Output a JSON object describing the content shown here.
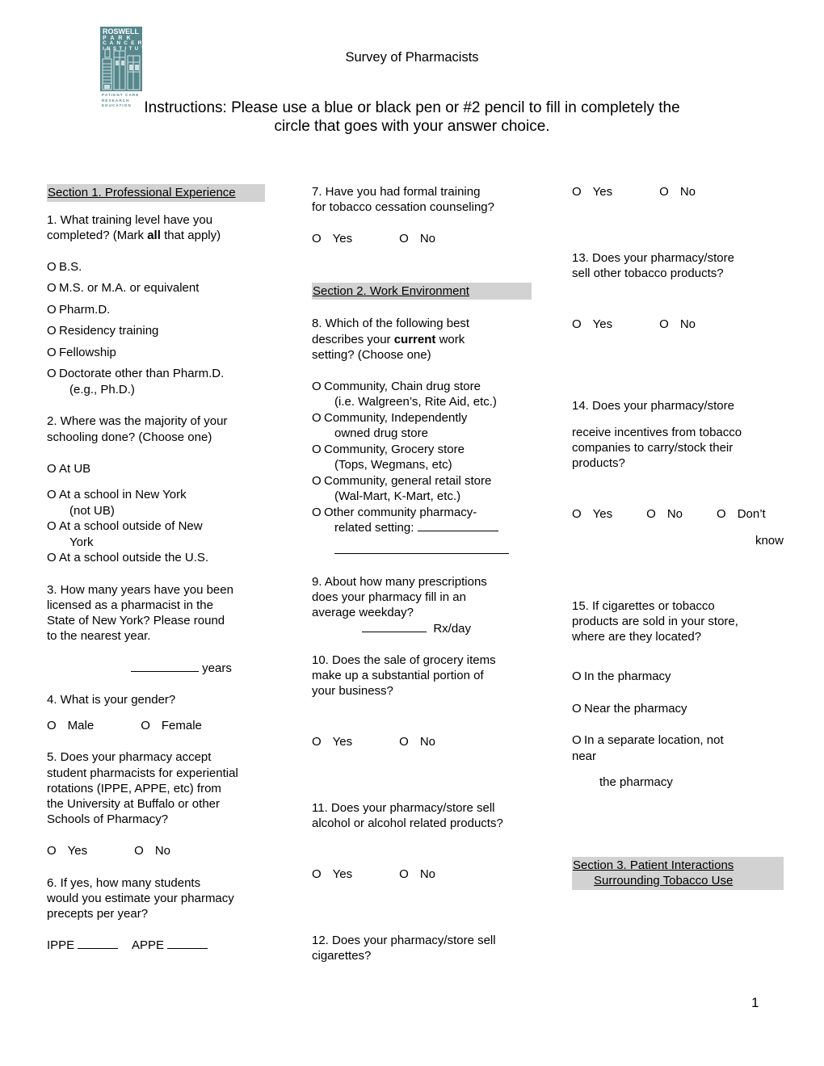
{
  "header": {
    "logo": {
      "name": "Roswell Park Cancer Institute",
      "line1": "ROSWELL",
      "line2": "P A R K",
      "line3": "C A N C E R",
      "line4": "I N S T I T U T E",
      "tag1": "PATIENT CARE",
      "tag2": "RESEARCH",
      "tag3": "EDUCATION",
      "color": "#55878c"
    },
    "title": "Survey of Pharmacists",
    "instructions_line1": "Instructions: Please use a blue or black pen or #2 pencil to fill in completely",
    "instructions_line2": "the circle that goes with your answer choice."
  },
  "sections": {
    "s1": "Section 1.  Professional Experience",
    "s2": "Section 2.  Work Environment",
    "s3_line1": "Section 3.  Patient Interactions ",
    "s3_line2": "Surrounding Tobacco Use"
  },
  "bubble": "O",
  "col1": {
    "q1": {
      "text_l1": "1.  What training level have you",
      "text_l2_a": "completed? (Mark ",
      "text_l2_b": "all",
      "text_l2_c": " that apply)",
      "options": [
        "B.S.",
        "M.S. or M.A. or equivalent",
        "Pharm.D.",
        "Residency training",
        "Fellowship",
        "Doctorate other than Pharm.D."
      ],
      "option6_cont": "(e.g., Ph.D.)"
    },
    "q2": {
      "text_l1": "2.  Where was the majority of your",
      "text_l2": "schooling done? (Choose one)",
      "options": [
        {
          "label": "At UB",
          "cont": ""
        },
        {
          "label": "At a school in New York",
          "cont": "(not UB)"
        },
        {
          "label": "At a school outside of New",
          "cont": "York"
        },
        {
          "label": "At a school outside the U.S.",
          "cont": ""
        }
      ]
    },
    "q3": {
      "text_l1": "3.  How many years have you been",
      "text_l2": "licensed as a pharmacist in the",
      "text_l3": "State of New York?  Please round",
      "text_l4": "to the nearest year.",
      "answer_unit": "years"
    },
    "q4": {
      "text": "4.   What is your gender?",
      "opt_a": "Male",
      "opt_b": "Female"
    },
    "q5": {
      "text_l1": "5.   Does your pharmacy accept",
      "text_l2": "student pharmacists for experiential",
      "text_l3": "rotations (IPPE, APPE, etc) from",
      "text_l4": "the University at Buffalo or other",
      "text_l5": "Schools of Pharmacy?",
      "opt_a": "Yes",
      "opt_b": "No"
    },
    "q6": {
      "text_l1": "6.   If yes, how many students",
      "text_l2": "would you estimate your pharmacy",
      "text_l3": "precepts per year?",
      "field_a": "IPPE",
      "field_b": "APPE"
    }
  },
  "col2": {
    "q7": {
      "text_l1": "7.   Have you had formal training",
      "text_l2": "for tobacco cessation counseling?",
      "opt_a": "Yes",
      "opt_b": "No"
    },
    "q8": {
      "text_l1": "8.   Which of the following best",
      "text_l2_a": "describes your ",
      "text_l2_b": "current",
      "text_l2_c": " work",
      "text_l3": "setting?  (Choose one)",
      "options": [
        {
          "label": "Community, Chain drug store",
          "cont": "(i.e. Walgreen’s, Rite Aid, etc.)"
        },
        {
          "label": "Community, Independently",
          "cont": "owned drug store"
        },
        {
          "label": "Community, Grocery store",
          "cont": "(Tops, Wegmans, etc)"
        },
        {
          "label": "Community, general retail store",
          "cont": "(Wal-Mart, K-Mart, etc.)"
        },
        {
          "label": "Other community pharmacy-",
          "cont": "related setting:  "
        }
      ]
    },
    "q9": {
      "text_l1": "9.   About how many prescriptions",
      "text_l2": "does your pharmacy fill in an",
      "text_l3": "average weekday?",
      "answer_unit": "Rx/day"
    },
    "q10": {
      "text_l1": "10.  Does the sale of grocery items",
      "text_l2": "make up a substantial portion of",
      "text_l3": "your business?",
      "opt_a": "Yes",
      "opt_b": "No"
    },
    "q11": {
      "text_l1": "11.  Does your pharmacy/store sell",
      "text_l2": "alcohol or alcohol related products?",
      "opt_a": "Yes",
      "opt_b": "No"
    },
    "q12": {
      "text_l1": "12.  Does your pharmacy/store sell",
      "text_l2": "cigarettes?"
    }
  },
  "col3": {
    "q12_answers": {
      "opt_a": "Yes",
      "opt_b": "No"
    },
    "q13": {
      "text_l1": "13.  Does your pharmacy/store",
      "text_l2": "sell other tobacco products?",
      "opt_a": "Yes",
      "opt_b": "No"
    },
    "q14": {
      "text_l1": "14.  Does your pharmacy/store",
      "text_l2": "receive incentives from tobacco",
      "text_l3": "companies to carry/stock their",
      "text_l4": "products?",
      "opt_a": "Yes",
      "opt_b": "No",
      "opt_c": "Don’t",
      "opt_c_cont": "know"
    },
    "q15": {
      "text_l1": "15.  If cigarettes or tobacco",
      "text_l2": "products are sold in your store,",
      "text_l3": "where are they located?",
      "options": [
        {
          "label": "In the pharmacy",
          "cont": ""
        },
        {
          "label": "Near the pharmacy",
          "cont": ""
        },
        {
          "label": "In a separate location, not",
          "cont": "near",
          "cont2": "the pharmacy"
        }
      ]
    }
  },
  "footer": {
    "page_number": "1"
  }
}
